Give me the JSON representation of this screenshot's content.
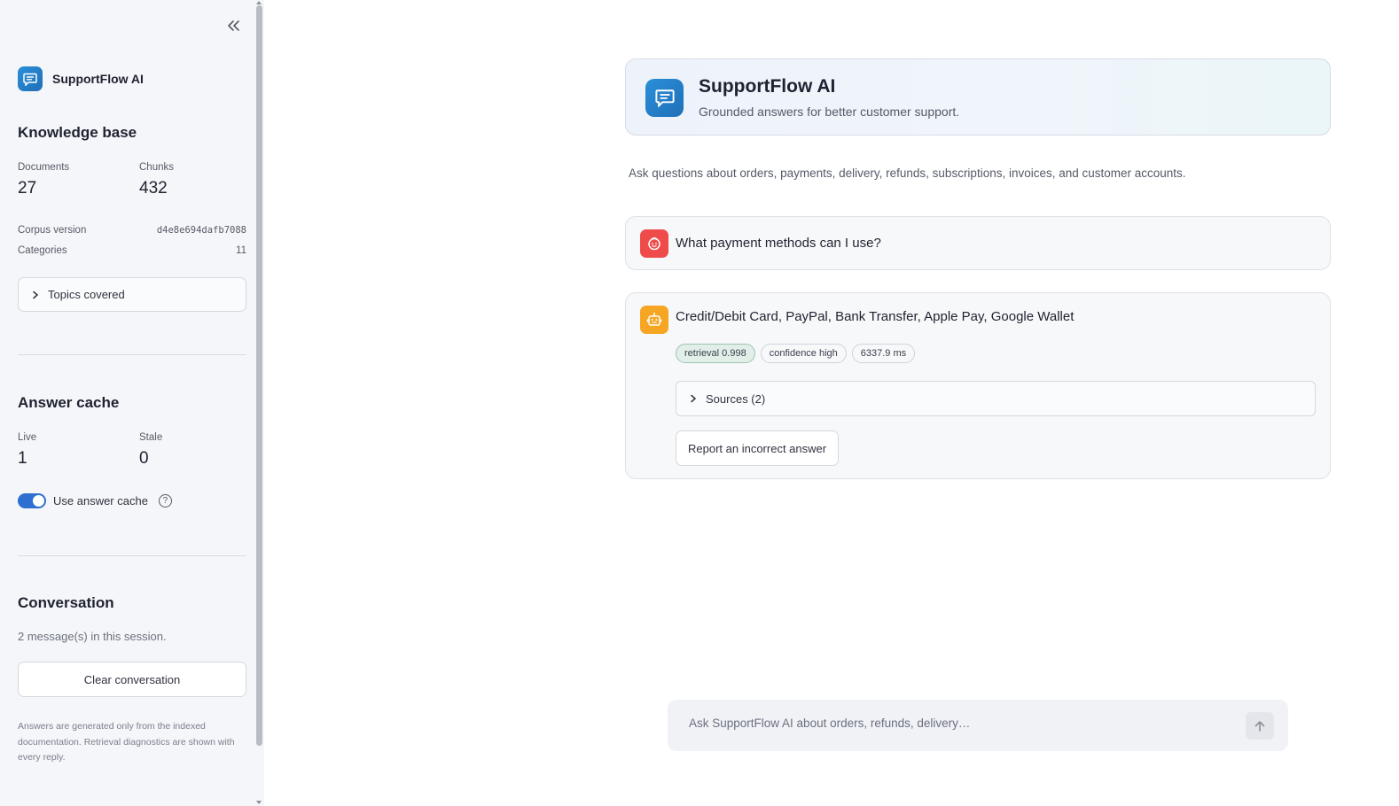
{
  "sidebar": {
    "brand_name": "SupportFlow AI",
    "knowledge_base": {
      "title": "Knowledge base",
      "documents_label": "Documents",
      "documents_value": "27",
      "chunks_label": "Chunks",
      "chunks_value": "432",
      "corpus_version_label": "Corpus version",
      "corpus_version_value": "d4e8e694dafb7088",
      "categories_label": "Categories",
      "categories_value": "11",
      "topics_expander": "Topics covered"
    },
    "answer_cache": {
      "title": "Answer cache",
      "live_label": "Live",
      "live_value": "1",
      "stale_label": "Stale",
      "stale_value": "0",
      "toggle_label": "Use answer cache",
      "toggle_on": true
    },
    "conversation": {
      "title": "Conversation",
      "session_text": "2 message(s) in this session.",
      "clear_button": "Clear conversation"
    },
    "footnote": "Answers are generated only from the indexed documentation. Retrieval diagnostics are shown with every reply."
  },
  "header": {
    "title": "SupportFlow AI",
    "subtitle": "Grounded answers for better customer support."
  },
  "intro_text": "Ask questions about orders, payments, delivery, refunds, subscriptions, invoices, and customer accounts.",
  "messages": [
    {
      "role": "user",
      "text": "What payment methods can I use?"
    },
    {
      "role": "assistant",
      "text": "Credit/Debit Card, PayPal, Bank Transfer, Apple Pay, Google Wallet",
      "pills": [
        "retrieval 0.998",
        "confidence high",
        "6337.9 ms"
      ],
      "sources_label": "Sources (2)",
      "report_button": "Report an incorrect answer"
    }
  ],
  "chat_input": {
    "placeholder": "Ask SupportFlow AI about orders, refunds, delivery…"
  },
  "colors": {
    "accent_blue": "#2f6fd1",
    "user_avatar": "#ef4b4b",
    "assistant_avatar": "#f6a623",
    "brand_logo": "#2a8fd8"
  }
}
